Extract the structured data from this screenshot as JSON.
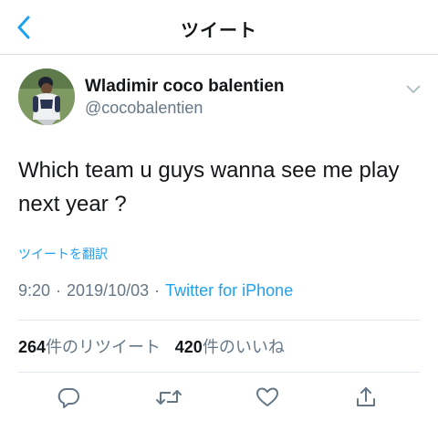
{
  "header": {
    "title": "ツイート",
    "back_icon": "chevron-left-icon"
  },
  "accent_color": "#1da1f2",
  "author": {
    "display_name": "Wladimir coco balentien",
    "username": "@cocobalentien"
  },
  "tweet": {
    "line1": "Which team u guys wanna see me play",
    "line2": "next year ?",
    "translate_label": "ツイートを翻訳",
    "time": "9:20",
    "date": "2019/10/03",
    "separator": "·",
    "client": "Twitter for iPhone"
  },
  "stats": {
    "retweets_count": "264",
    "retweets_label": "件のリツイート",
    "likes_count": "420",
    "likes_label": "件のいいね"
  },
  "actions": [
    "reply-icon",
    "retweet-icon",
    "like-icon",
    "share-icon"
  ]
}
